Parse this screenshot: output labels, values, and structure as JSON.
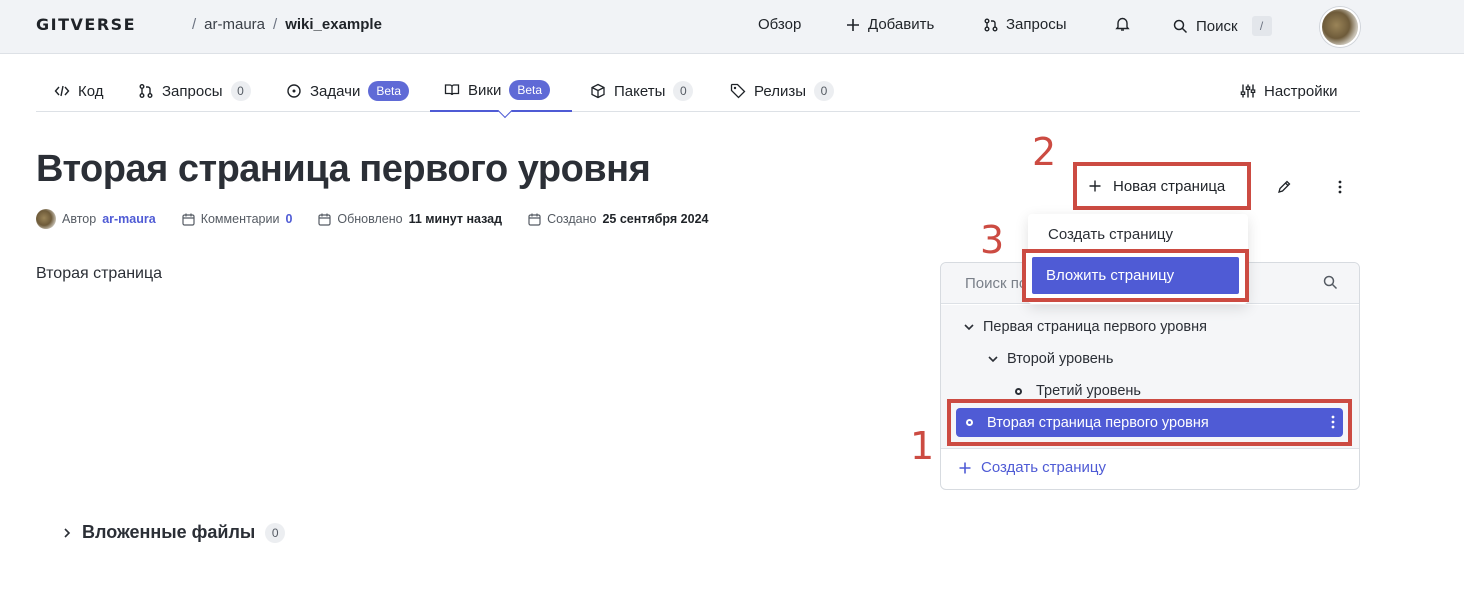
{
  "header": {
    "logo": "GITVERSE",
    "breadcrumb": {
      "owner": "ar-maura",
      "separator": "/",
      "repo": "wiki_example"
    },
    "nav": {
      "overview": "Обзор",
      "add": "Добавить",
      "requests": "Запросы",
      "search": "Поиск",
      "search_shortcut": "/"
    }
  },
  "tabs": [
    {
      "label": "Код",
      "icon": "code-icon"
    },
    {
      "label": "Запросы",
      "icon": "pull-request-icon",
      "count": "0"
    },
    {
      "label": "Задачи",
      "icon": "issue-icon",
      "badge": "Beta"
    },
    {
      "label": "Вики",
      "icon": "book-icon",
      "badge": "Beta",
      "active": true
    },
    {
      "label": "Пакеты",
      "icon": "package-icon",
      "count": "0"
    },
    {
      "label": "Релизы",
      "icon": "tag-icon",
      "count": "0"
    },
    {
      "label": "Настройки",
      "icon": "sliders-icon"
    }
  ],
  "page": {
    "title": "Вторая страница первого уровня",
    "meta": {
      "author_label": "Автор",
      "author": "ar-maura",
      "comments_label": "Комментарии",
      "comments": "0",
      "updated_label": "Обновлено",
      "updated": "11 минут назад",
      "created_label": "Создано",
      "created": "25 сентября 2024"
    },
    "content": "Вторая страница",
    "attachments": {
      "label": "Вложенные файлы",
      "count": "0"
    }
  },
  "actions": {
    "new_page": "Новая страница",
    "dropdown": [
      "Создать страницу",
      "Вложить страницу"
    ]
  },
  "wiki_tree": {
    "search_placeholder": "Поиск по страницам",
    "items": [
      {
        "label": "Первая страница первого уровня",
        "level": 1,
        "expanded": true
      },
      {
        "label": "Второй уровень",
        "level": 2,
        "expanded": true
      },
      {
        "label": "Третий уровень",
        "level": 3
      },
      {
        "label": "Вторая страница первого уровня",
        "level": 1,
        "selected": true
      }
    ],
    "create_page": "Создать страницу"
  },
  "annotations": {
    "step1": "1",
    "step2": "2",
    "step3": "3"
  },
  "colors": {
    "accent": "#4f5bd5",
    "annotation": "#cc4b42",
    "header_bg": "#f1f3f6"
  }
}
